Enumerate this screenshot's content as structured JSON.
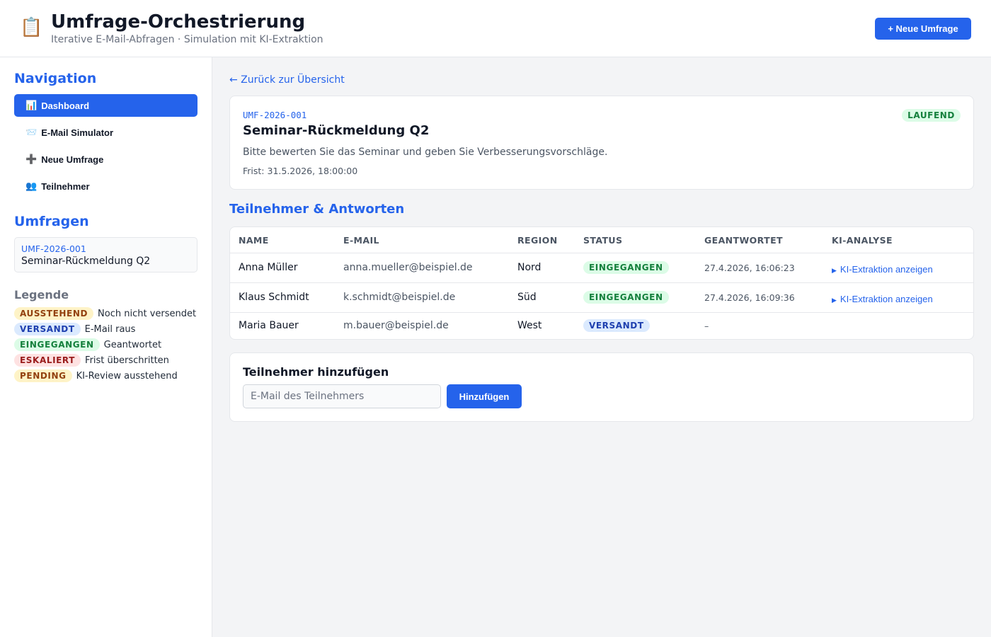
{
  "header": {
    "icon": "clipboard-icon",
    "title": "Umfrage-Orchestrierung",
    "subtitle": "Iterative E-Mail-Abfragen · Simulation mit KI-Extraktion",
    "new_survey_button": "+ Neue Umfrage"
  },
  "sidebar": {
    "nav_title": "Navigation",
    "nav_items": [
      {
        "icon": "📊",
        "icon_name": "chart-icon",
        "label": "Dashboard",
        "active": true
      },
      {
        "icon": "📨",
        "icon_name": "envelope-icon",
        "label": "E-Mail Simulator",
        "active": false
      },
      {
        "icon": "➕",
        "icon_name": "plus-icon",
        "label": "Neue Umfrage",
        "active": false
      },
      {
        "icon": "👥",
        "icon_name": "people-icon",
        "label": "Teilnehmer",
        "active": false
      }
    ],
    "surveys_title": "Umfragen",
    "surveys": [
      {
        "id": "UMF-2026-001",
        "name": "Seminar-Rückmeldung Q2"
      }
    ],
    "legend_title": "Legende",
    "legend": [
      {
        "badge": "AUSSTEHEND",
        "text": "Noch nicht versendet",
        "color": "yellow"
      },
      {
        "badge": "VERSANDT",
        "text": "E-Mail raus",
        "color": "blue"
      },
      {
        "badge": "EINGEGANGEN",
        "text": "Geantwortet",
        "color": "green"
      },
      {
        "badge": "ESKALIERT",
        "text": "Frist überschritten",
        "color": "red"
      },
      {
        "badge": "PENDING",
        "text": "KI-Review ausstehend",
        "color": "yellow"
      }
    ]
  },
  "main": {
    "back_link": "← Zurück zur Übersicht",
    "survey": {
      "id": "UMF-2026-001",
      "title": "Seminar-Rückmeldung Q2",
      "description": "Bitte bewerten Sie das Seminar und geben Sie Verbesserungsvorschläge.",
      "deadline": "Frist: 31.5.2026, 18:00:00",
      "status": "LAUFEND"
    },
    "participants_title": "Teilnehmer & Antworten",
    "table": {
      "headers": [
        "NAME",
        "E-MAIL",
        "REGION",
        "STATUS",
        "GEANTWORTET",
        "KI-ANALYSE"
      ],
      "rows": [
        {
          "name": "Anna Müller",
          "email": "anna.mueller@beispiel.de",
          "region": "Nord",
          "status": "EINGEGANGEN",
          "status_color": "green",
          "answered": "27.4.2026, 16:06:23",
          "ki": "KI-Extraktion anzeigen"
        },
        {
          "name": "Klaus Schmidt",
          "email": "k.schmidt@beispiel.de",
          "region": "Süd",
          "status": "EINGEGANGEN",
          "status_color": "green",
          "answered": "27.4.2026, 16:09:36",
          "ki": "KI-Extraktion anzeigen"
        },
        {
          "name": "Maria Bauer",
          "email": "m.bauer@beispiel.de",
          "region": "West",
          "status": "VERSANDT",
          "status_color": "blue",
          "answered": "–",
          "ki": ""
        }
      ]
    },
    "add": {
      "title": "Teilnehmer hinzufügen",
      "placeholder": "E-Mail des Teilnehmers",
      "button": "Hinzufügen"
    }
  },
  "colors": {
    "accent": "#2563eb",
    "green_badge_bg": "#dcfce7",
    "green_badge_text": "#15803d",
    "blue_badge_bg": "#dbeafe",
    "blue_badge_text": "#1e40af",
    "yellow_badge_bg": "#fef3c7",
    "yellow_badge_text": "#92400e",
    "red_badge_bg": "#fee2e2",
    "red_badge_text": "#991b1b"
  }
}
